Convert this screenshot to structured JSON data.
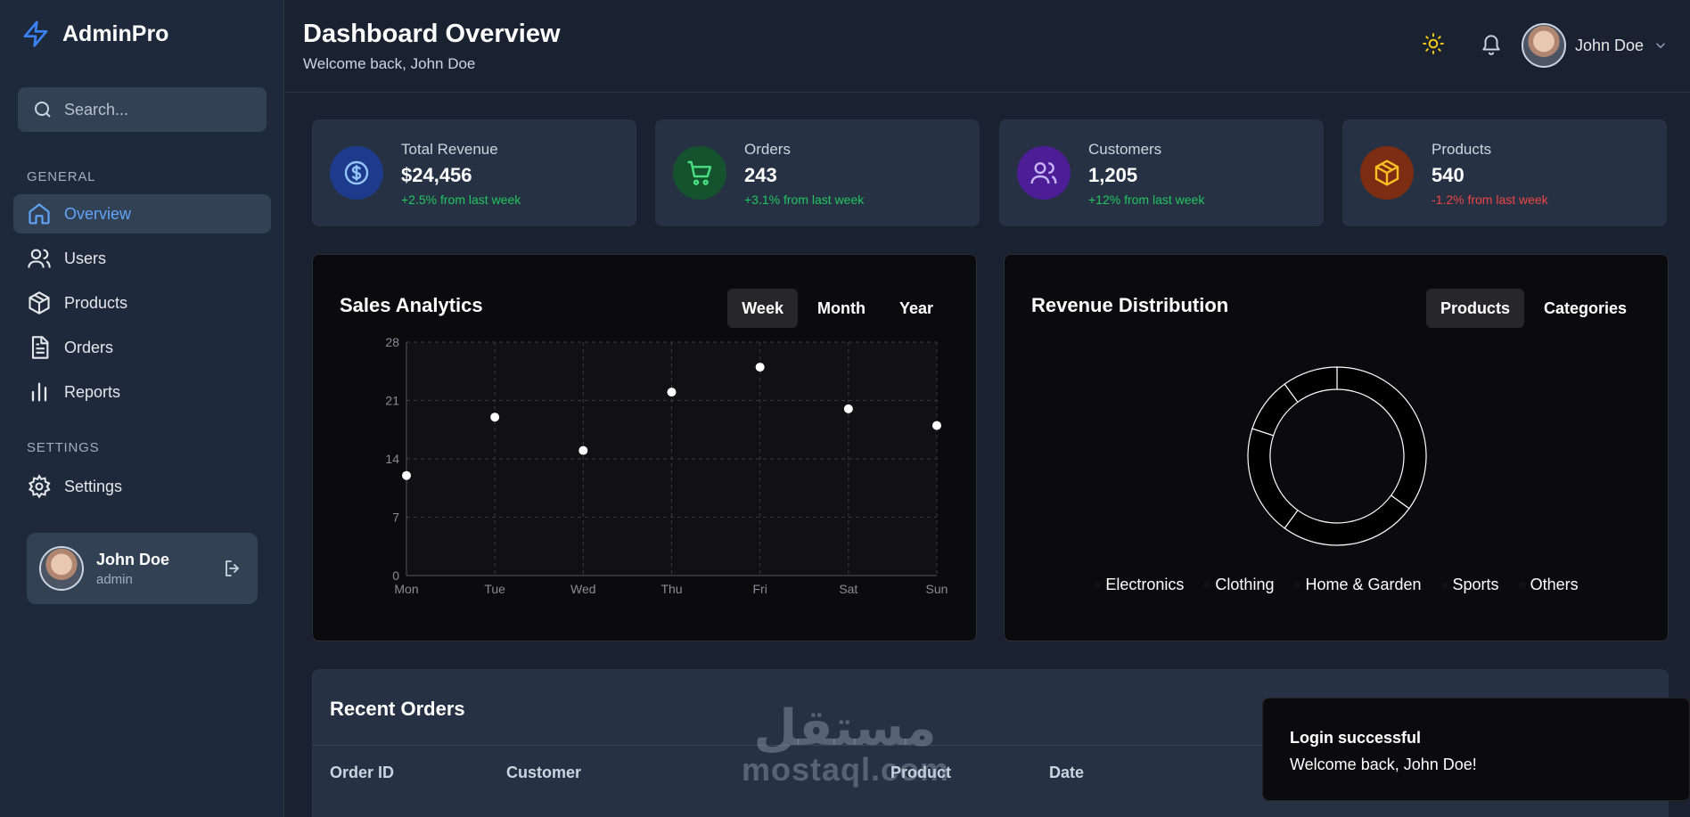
{
  "brand": {
    "name": "AdminPro"
  },
  "search": {
    "placeholder": "Search..."
  },
  "sidebar": {
    "general_label": "GENERAL",
    "settings_label": "SETTINGS",
    "items": [
      {
        "label": "Overview",
        "icon": "home-icon",
        "active": true
      },
      {
        "label": "Users",
        "icon": "users-icon"
      },
      {
        "label": "Products",
        "icon": "box-icon"
      },
      {
        "label": "Orders",
        "icon": "document-icon"
      },
      {
        "label": "Reports",
        "icon": "bar-chart-icon"
      }
    ],
    "settings_item": {
      "label": "Settings",
      "icon": "gear-icon"
    },
    "user": {
      "name": "John Doe",
      "role": "admin"
    }
  },
  "header": {
    "title": "Dashboard Overview",
    "subtitle": "Welcome back, John Doe",
    "user_name": "John Doe"
  },
  "stats": [
    {
      "label": "Total Revenue",
      "value": "$24,456",
      "change": "+2.5% from last week",
      "color": "#1e3a8a",
      "icon": "dollar-icon"
    },
    {
      "label": "Orders",
      "value": "243",
      "change": "+3.1% from last week",
      "color": "#14532d",
      "icon": "cart-icon"
    },
    {
      "label": "Customers",
      "value": "1,205",
      "change": "+12% from last week",
      "color": "#4c1d95",
      "icon": "users-icon"
    },
    {
      "label": "Products",
      "value": "540",
      "change": "-1.2% from last week",
      "color": "#7c2d12",
      "icon": "box-icon"
    }
  ],
  "sales_panel": {
    "title": "Sales Analytics",
    "tabs": [
      "Week",
      "Month",
      "Year"
    ],
    "active_tab": "Week"
  },
  "revenue_panel": {
    "title": "Revenue Distribution",
    "tabs": [
      "Products",
      "Categories"
    ],
    "active_tab": "Products"
  },
  "chart_data": [
    {
      "type": "scatter",
      "title": "Sales Analytics",
      "categories": [
        "Mon",
        "Tue",
        "Wed",
        "Thu",
        "Fri",
        "Sat",
        "Sun"
      ],
      "values": [
        12,
        19,
        15,
        22,
        25,
        20,
        18
      ],
      "ylim": [
        0,
        28
      ],
      "yticks": [
        0,
        7,
        14,
        21,
        28
      ],
      "grid": true
    },
    {
      "type": "pie",
      "title": "Revenue Distribution",
      "donut": true,
      "labels": [
        "Electronics",
        "Clothing",
        "Home & Garden",
        "Sports",
        "Others"
      ],
      "values": [
        35,
        25,
        20,
        10,
        10
      ],
      "legend": "bottom"
    }
  ],
  "orders": {
    "title": "Recent Orders",
    "columns": [
      "Order ID",
      "Customer",
      "Product",
      "Date"
    ]
  },
  "watermark": {
    "arabic": "مستقل",
    "latin": "mostaql.com"
  },
  "toast": {
    "title": "Login successful",
    "message": "Welcome back, John Doe!"
  }
}
